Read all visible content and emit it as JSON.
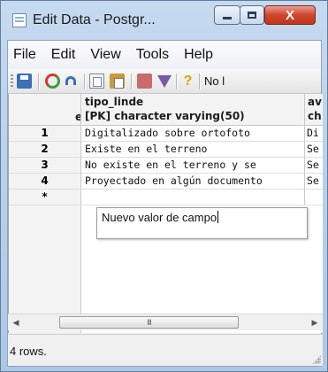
{
  "window": {
    "title": "Edit Data - Postgr...",
    "controls": {
      "minimize": "",
      "maximize": "",
      "close": "X"
    }
  },
  "menu": {
    "items": [
      "File",
      "Edit",
      "View",
      "Tools",
      "Help"
    ]
  },
  "toolbar": {
    "icons": [
      "save-icon",
      "refresh-icon",
      "undo-icon",
      "copy-icon",
      "paste-icon",
      "delete-icon",
      "filter-icon",
      "help-icon"
    ],
    "help_glyph": "?",
    "limit_label": "No l"
  },
  "grid": {
    "rownum_header": "eri",
    "columns": [
      {
        "name": "tipo_linde",
        "type": "[PK] character varying(50)"
      },
      {
        "name": "av",
        "type": "ch"
      }
    ],
    "rows": [
      {
        "num": "1",
        "tipo_linde": "Digitalizado sobre ortofoto",
        "next": "Di"
      },
      {
        "num": "2",
        "tipo_linde": "Existe en el terreno",
        "next": "Se"
      },
      {
        "num": "3",
        "tipo_linde": "No existe en el terreno y se",
        "next": "Se"
      },
      {
        "num": "4",
        "tipo_linde": "Proyectado en algún documento",
        "next": "Se"
      }
    ],
    "new_row_marker": "*",
    "editor_value": "Nuevo valor de campo"
  },
  "scrollbar": {
    "thumb_grip": "III",
    "left_arrow": "◀",
    "right_arrow": "▶"
  },
  "status": {
    "text": "4 rows."
  }
}
